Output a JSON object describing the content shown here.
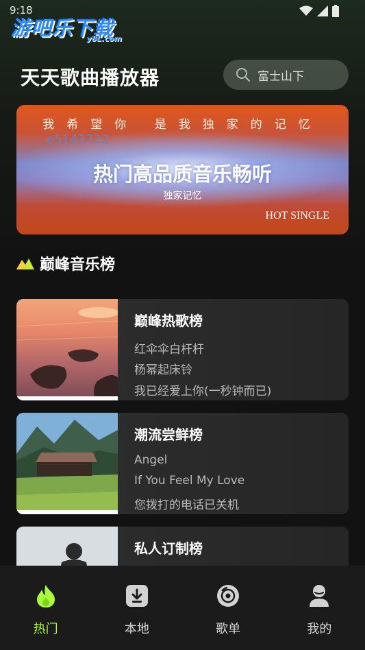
{
  "status_bar": {
    "time": "9:18"
  },
  "watermark": {
    "main": "游吧乐下载",
    "sub": "y8L.com"
  },
  "header": {
    "title": "天天歌曲播放器"
  },
  "search": {
    "placeholder": "富士山下",
    "icon": "search-icon"
  },
  "banner": {
    "line1": "我希望你 是我独家的记忆",
    "code": "e5143722",
    "title": "热门高品质音乐畅听",
    "subtitle": "独家记忆",
    "tag": "HOT SINGLE"
  },
  "section": {
    "title": "巅峰音乐榜",
    "icon": "mountain-icon"
  },
  "charts": [
    {
      "title": "巅峰热歌榜",
      "songs": [
        "红伞伞白杆杆",
        "杨幂起床铃",
        "我已经爱上你(一秒钟而已)"
      ]
    },
    {
      "title": "潮流尝鲜榜",
      "songs": [
        "Angel",
        "If You Feel My Love",
        "您拨打的电话已关机"
      ]
    },
    {
      "title": "私人订制榜",
      "songs": []
    }
  ],
  "nav": {
    "items": [
      {
        "label": "热门",
        "icon": "flame-icon",
        "active": true
      },
      {
        "label": "本地",
        "icon": "download-icon",
        "active": false
      },
      {
        "label": "歌单",
        "icon": "disc-icon",
        "active": false
      },
      {
        "label": "我的",
        "icon": "user-icon",
        "active": false
      }
    ]
  },
  "colors": {
    "accent": "#a8ff3a",
    "background": "#121212",
    "card": "#2a2a2a"
  }
}
